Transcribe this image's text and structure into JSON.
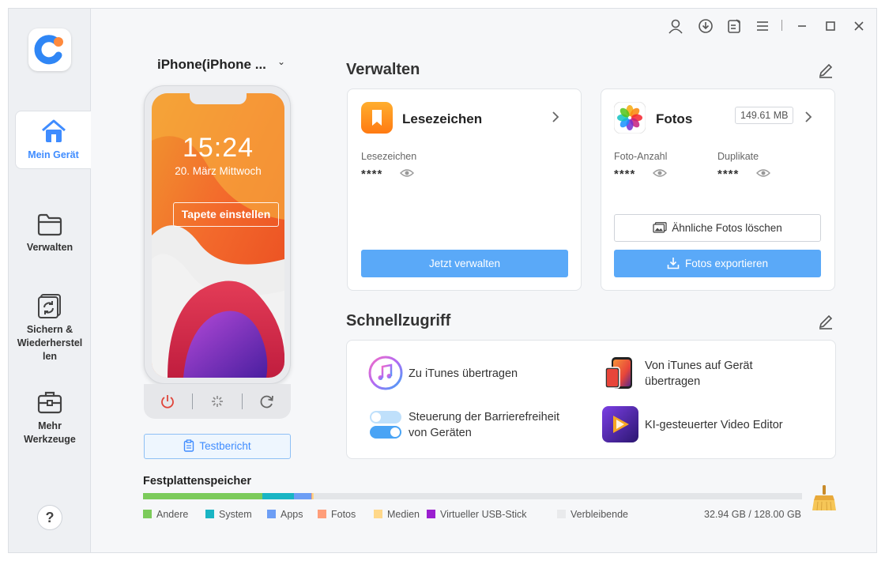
{
  "sidebar": {
    "items": [
      {
        "label": "Mein Gerät",
        "icon": "home-icon",
        "active": true
      },
      {
        "label": "Verwalten",
        "icon": "folder-icon"
      },
      {
        "label": "Sichern & Wiederherstellen",
        "label_lines": [
          "Sichern &",
          "Wiederherstel",
          "len"
        ],
        "icon": "backup-restore-icon"
      },
      {
        "label": "Mehr Werkzeuge",
        "label_lines": [
          "Mehr",
          "Werkzeuge"
        ],
        "icon": "toolbox-icon"
      }
    ],
    "help_label": "?"
  },
  "device": {
    "name": "iPhone(iPhone ...",
    "time": "15:24",
    "date": "20. März Mittwoch",
    "wallpaper_button": "Tapete einstellen",
    "report_button": "Testbericht"
  },
  "manage": {
    "title": "Verwalten",
    "bookmarks": {
      "title": "Lesezeichen",
      "field_label": "Lesezeichen",
      "field_value": "****",
      "button": "Jetzt verwalten"
    },
    "photos": {
      "title": "Fotos",
      "size": "149.61 MB",
      "count_label": "Foto-Anzahl",
      "count_value": "****",
      "dup_label": "Duplikate",
      "dup_value": "****",
      "similar_button": "Ähnliche Fotos löschen",
      "export_button": "Fotos exportieren"
    }
  },
  "quick_access": {
    "title": "Schnellzugriff",
    "items": [
      {
        "label": "Zu iTunes übertragen",
        "lines": [
          "Zu iTunes übertragen"
        ],
        "icon": "itunes-icon"
      },
      {
        "label": "Von iTunes auf Gerät übertragen",
        "lines": [
          "Von iTunes auf Gerät",
          "übertragen"
        ],
        "icon": "itunes-to-device-icon"
      },
      {
        "label": "Steuerung der Barrierefreiheit von Geräten",
        "lines": [
          "Steuerung der Barrierefreiheit",
          "von Geräten"
        ],
        "icon": "accessibility-toggle-icon"
      },
      {
        "label": "KI-gesteuerter Video Editor",
        "lines": [
          "KI-gesteuerter Video Editor"
        ],
        "icon": "video-editor-icon"
      }
    ]
  },
  "storage": {
    "title": "Festplattenspeicher",
    "used": "32.94 GB / 128.00 GB",
    "segments": [
      {
        "name": "Andere",
        "color": "#7ccb5b",
        "fraction": 0.181
      },
      {
        "name": "System",
        "color": "#19b5c4",
        "fraction": 0.048
      },
      {
        "name": "Apps",
        "color": "#6d9ef5",
        "fraction": 0.026
      },
      {
        "name": "Fotos",
        "color": "#ff9e7a",
        "fraction": 0.002
      },
      {
        "name": "Medien",
        "color": "#ffd88a",
        "fraction": 0.001
      },
      {
        "name": "Virtueller USB-Stick",
        "color": "#9b1fd0",
        "fraction": 0.0
      },
      {
        "name": "Verbleibende",
        "color": "#e9eaec",
        "fraction": 0.742
      }
    ]
  },
  "colors": {
    "accent": "#3f8cff",
    "button": "#5aa9f8"
  }
}
